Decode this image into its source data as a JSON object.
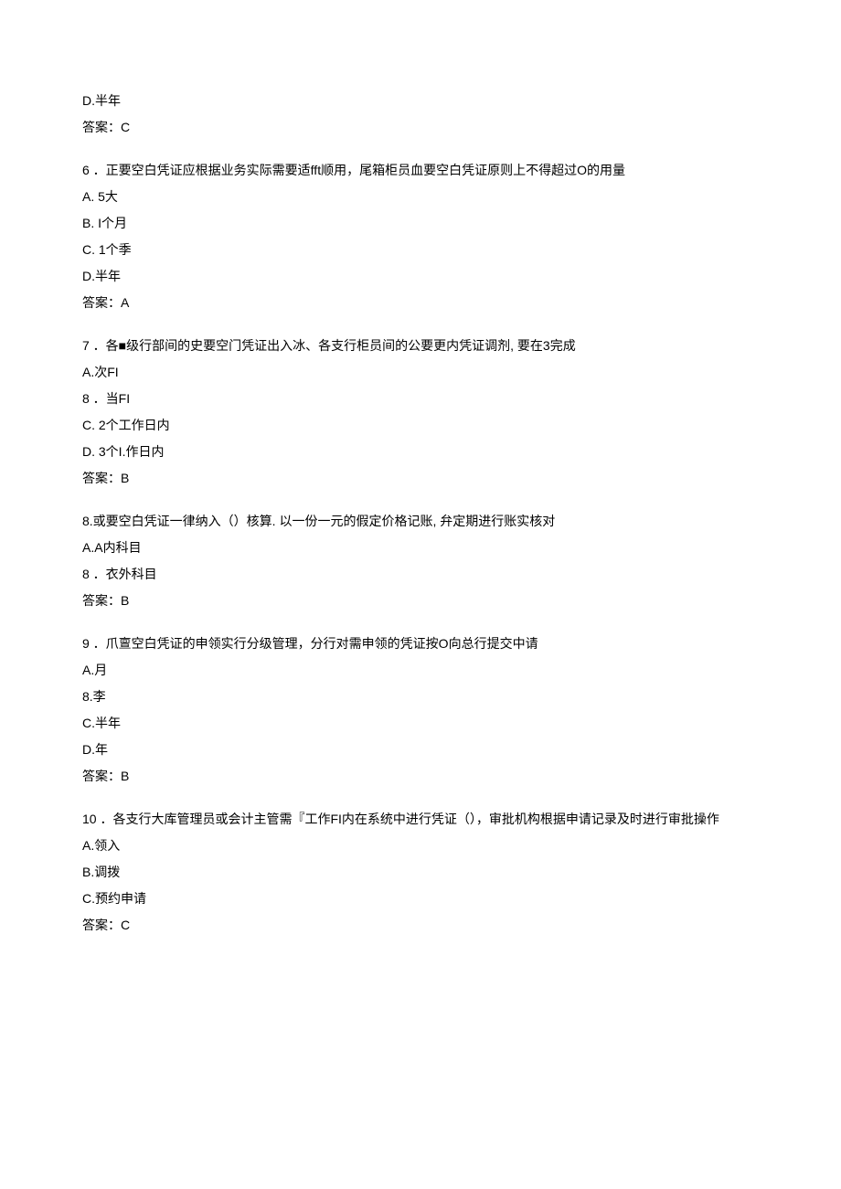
{
  "q5_tail": {
    "optD": "D.半年",
    "answer": "答案：C"
  },
  "q6": {
    "stem": "6 ．正要空白凭证应根据业务实际需要适fft顺用，尾箱柜员血要空白凭证原则上不得超过O的用量",
    "optA": "A.   5大",
    "optB": "B.   I个月",
    "optC": "C.   1个季",
    "optD": "D.半年",
    "answer": "答案：A"
  },
  "q7": {
    "stem": "7 ．各■级行部间的史要空门凭证出入冰、各支行柜员间的公要更内凭证调剂, 要在3完成",
    "optA": "A.次FI",
    "optB": "8 ．当FI",
    "optC": "C.   2个工作日内",
    "optD": "D.   3个I.作日内",
    "answer": "答案：B"
  },
  "q8": {
    "stem": "8.或要空白凭证一律纳入（）核算. 以一份一元的假定价格记账, 弁定期进行账实核对",
    "optA": "A.A内科目",
    "optB": "8 ．衣外科目",
    "answer": "答案：B"
  },
  "q9": {
    "stem": "9 ．爪亶空白凭证的申领实行分级管理，分行对需申领的凭证按O向总行提交中请",
    "optA": "A.月",
    "optB": "8.李",
    "optC": "C.半年",
    "optD": "D.年",
    "answer": "答案：B"
  },
  "q10": {
    "stem": "10 ．各支行大库管理员或会计主管需『工作FI内在系统中进行凭证（），审批机构根据申请记录及时进行审批操作",
    "optA": "A.领入",
    "optB": "B.调拨",
    "optC": "C.预约申请",
    "answer": "答案：C"
  }
}
